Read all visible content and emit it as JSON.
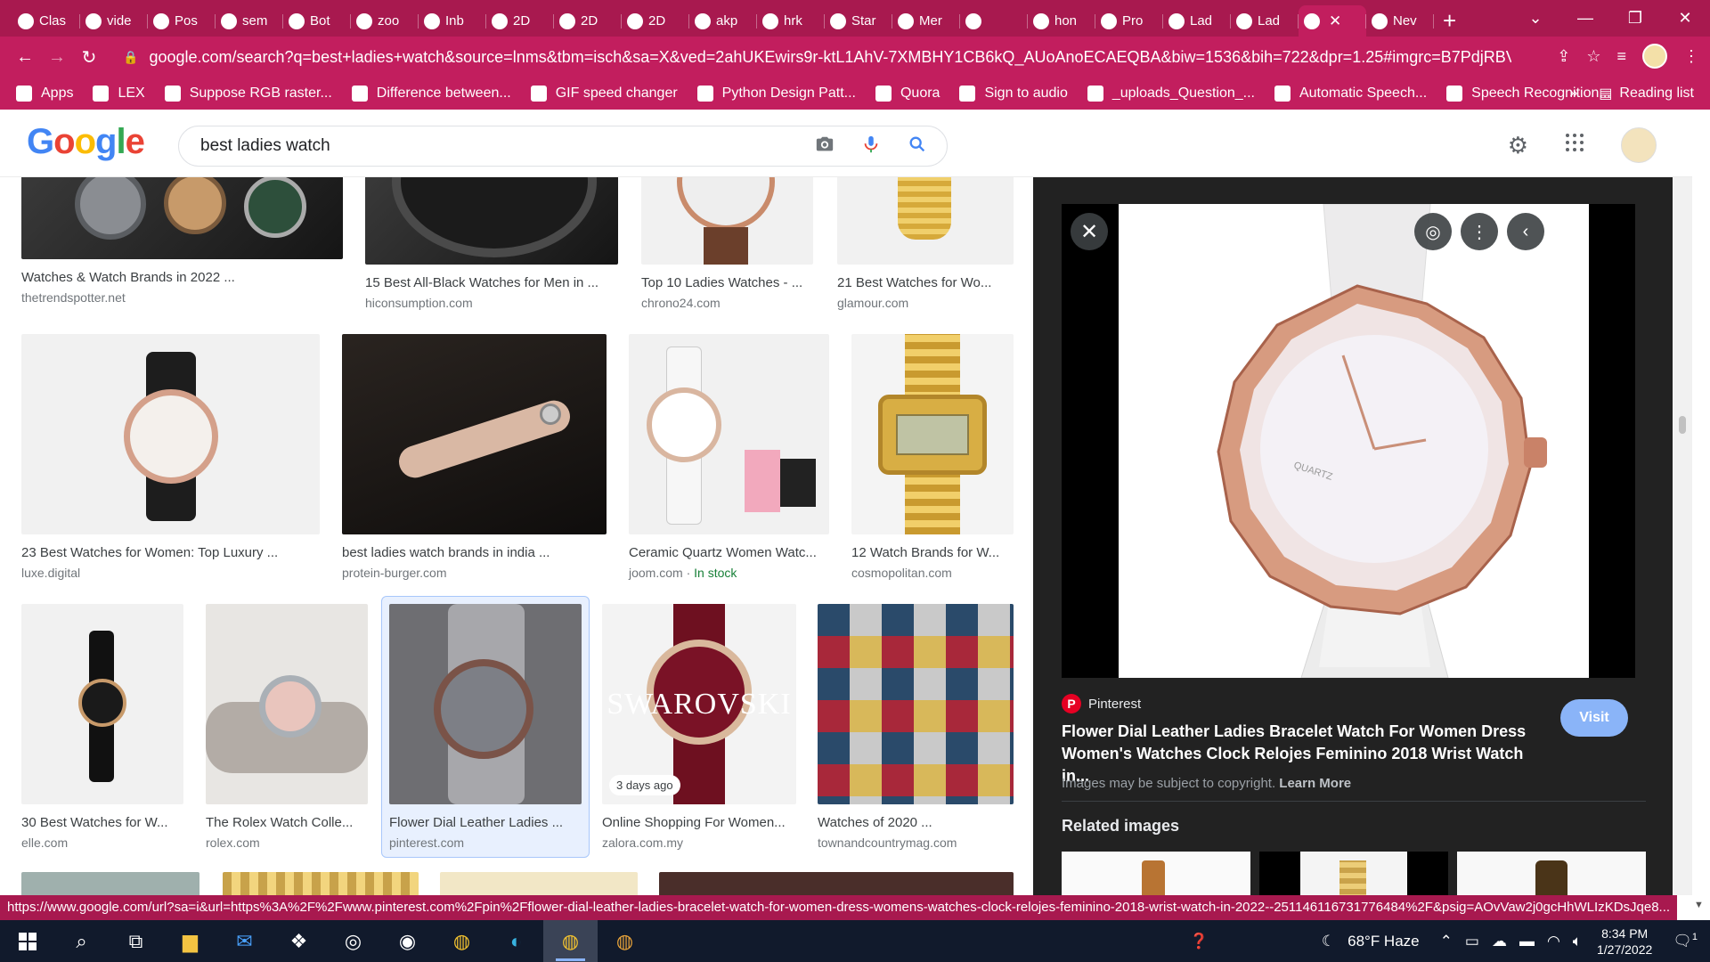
{
  "tabs": [
    {
      "label": "Clas"
    },
    {
      "label": "vide"
    },
    {
      "label": "Pos"
    },
    {
      "label": "sem"
    },
    {
      "label": "Bot"
    },
    {
      "label": "zoo"
    },
    {
      "label": "Inb"
    },
    {
      "label": "2D"
    },
    {
      "label": "2D"
    },
    {
      "label": "2D"
    },
    {
      "label": "akp"
    },
    {
      "label": "hrk"
    },
    {
      "label": "Star"
    },
    {
      "label": "Mer"
    },
    {
      "label": ""
    },
    {
      "label": "hon"
    },
    {
      "label": "Pro"
    },
    {
      "label": "Lad"
    },
    {
      "label": "Lad"
    },
    {
      "label": ""
    },
    {
      "label": "Nev"
    }
  ],
  "address": {
    "url": "google.com/search?q=best+ladies+watch&source=lnms&tbm=isch&sa=X&ved=2ahUKEwirs9r-ktL1AhV-7XMBHY1CB6kQ_AUoAnoECAEQBA&biw=1536&bih=722&dpr=1.25#imgrc=B7PdjRBVBG..."
  },
  "bookmarks": [
    {
      "label": "Apps"
    },
    {
      "label": "LEX"
    },
    {
      "label": "Suppose RGB raster..."
    },
    {
      "label": "Difference between..."
    },
    {
      "label": "GIF speed changer"
    },
    {
      "label": "Python Design Patt..."
    },
    {
      "label": "Quora"
    },
    {
      "label": "Sign to audio"
    },
    {
      "label": "_uploads_Question_..."
    },
    {
      "label": "Automatic Speech..."
    },
    {
      "label": "Speech Recognition..."
    }
  ],
  "bookmarks_more": "»",
  "reading_list": "Reading list",
  "search": {
    "query": "best ladies watch"
  },
  "results": [
    {
      "title": "Watches & Watch Brands in 2022 ...",
      "source": "thetrendspotter.net"
    },
    {
      "title": "15 Best All-Black Watches for Men in ...",
      "source": "hiconsumption.com"
    },
    {
      "title": "Top 10 Ladies Watches - ...",
      "source": "chrono24.com"
    },
    {
      "title": "21 Best Watches for Wo...",
      "source": "glamour.com"
    },
    {
      "title": "23 Best Watches for Women: Top Luxury ...",
      "source": "luxe.digital"
    },
    {
      "title": "best ladies watch brands in india ...",
      "source": "protein-burger.com"
    },
    {
      "title": "Ceramic Quartz Women Watc...",
      "source": "joom.com",
      "stock": "In stock"
    },
    {
      "title": "12 Watch Brands for W...",
      "source": "cosmopolitan.com"
    },
    {
      "title": "30 Best Watches for W...",
      "source": "elle.com"
    },
    {
      "title": "The Rolex Watch Colle...",
      "source": "rolex.com"
    },
    {
      "title": "Flower Dial Leather Ladies ...",
      "source": "pinterest.com"
    },
    {
      "title": "Online Shopping For Women...",
      "source": "zalora.com.my",
      "badge": "3 days ago",
      "overlay": "SWAROVSKI"
    },
    {
      "title": "Watches of 2020 ...",
      "source": "townandcountrymag.com"
    }
  ],
  "panel": {
    "source": "Pinterest",
    "title": "Flower Dial Leather Ladies Bracelet Watch For Women Dress Women's Watches Clock Relojes Feminino 2018 Wrist Watch in...",
    "visit": "Visit",
    "copyright": "Images may be subject to copyright.",
    "learn_more": "Learn More",
    "related": "Related images",
    "dial_text": "QUARTZ"
  },
  "status_url": "https://www.google.com/url?sa=i&url=https%3A%2F%2Fwww.pinterest.com%2Fpin%2Fflower-dial-leather-ladies-bracelet-watch-for-women-dress-womens-watches-clock-relojes-feminino-2018-wrist-watch-in-2022--251146116731776484%2F&psig=AOvVaw2j0gcHhWLIzKDsJqe8...",
  "taskbar": {
    "weather": "68°F Haze",
    "time": "8:34 PM",
    "date": "1/27/2022",
    "notifications": "1"
  },
  "colors": {
    "browser_accent": "#c21e5e",
    "google_blue": "#4285f4",
    "panel_bg": "#222222",
    "visit_button": "#8ab4f8",
    "pinterest": "#e60023"
  }
}
